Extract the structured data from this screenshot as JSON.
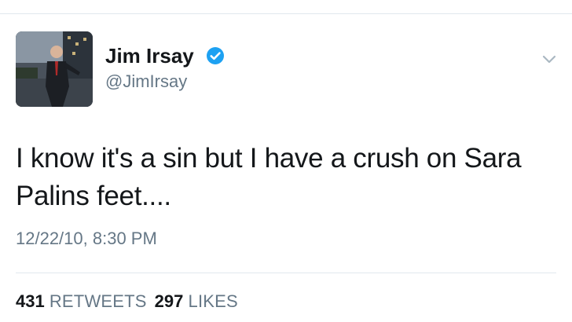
{
  "tweet": {
    "author": {
      "display_name": "Jim Irsay",
      "handle": "@JimIrsay",
      "verified": true,
      "avatar_icon": "profile-photo"
    },
    "menu_icon": "chevron-down-icon",
    "text": "I know it's a sin but I have a crush on Sara Palins feet....",
    "timestamp": "12/22/10, 8:30 PM",
    "stats": {
      "retweets_count": "431",
      "retweets_label": "RETWEETS",
      "likes_count": "297",
      "likes_label": "LIKES"
    }
  },
  "colors": {
    "text_primary": "#14171a",
    "text_secondary": "#657786",
    "verified_blue": "#1da1f2",
    "divider": "#e1e8ed"
  }
}
